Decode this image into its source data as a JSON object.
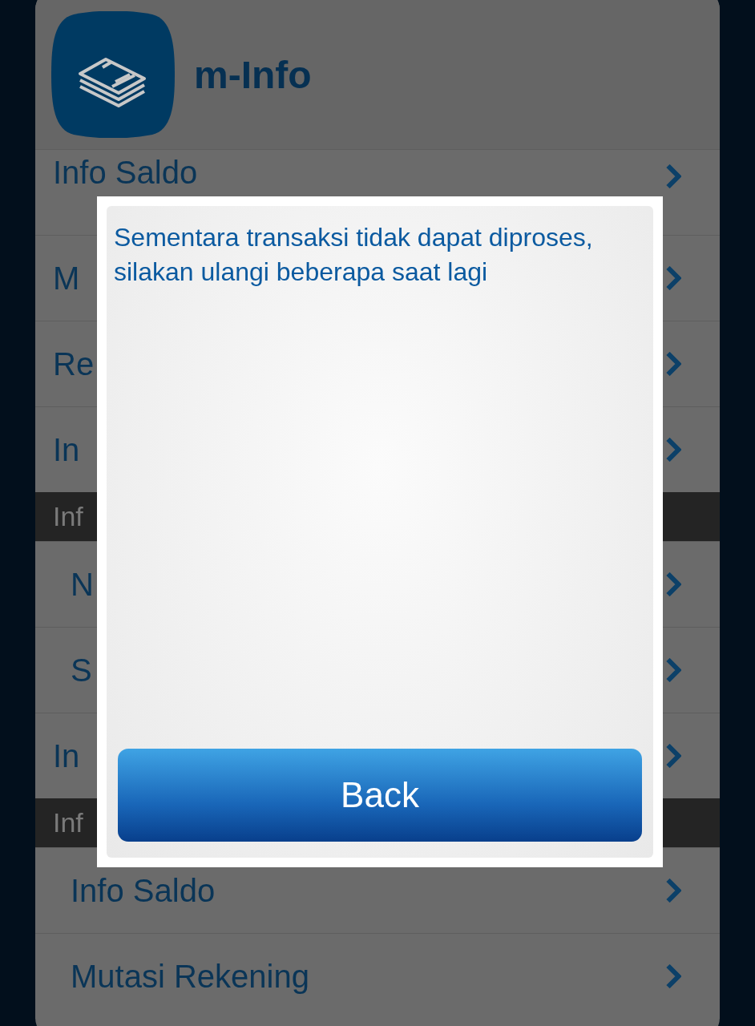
{
  "header": {
    "title": "m-Info"
  },
  "menu": [
    {
      "kind": "item",
      "label": "Info Saldo",
      "indented": false
    },
    {
      "kind": "item",
      "label": "M",
      "indented": false
    },
    {
      "kind": "item",
      "label": "Re",
      "indented": false
    },
    {
      "kind": "item",
      "label": "In",
      "indented": false
    },
    {
      "kind": "section",
      "label": "Inf"
    },
    {
      "kind": "item",
      "label": "N",
      "indented": true
    },
    {
      "kind": "item",
      "label": "S",
      "indented": true
    },
    {
      "kind": "item",
      "label": "In",
      "indented": false
    },
    {
      "kind": "section",
      "label": "Inf"
    },
    {
      "kind": "item",
      "label": "Info Saldo",
      "indented": true
    },
    {
      "kind": "item",
      "label": "Mutasi Rekening",
      "indented": true
    }
  ],
  "dialog": {
    "message": "Sementara transaksi tidak dapat diproses, silakan ulangi beberapa saat lagi",
    "button": "Back"
  }
}
